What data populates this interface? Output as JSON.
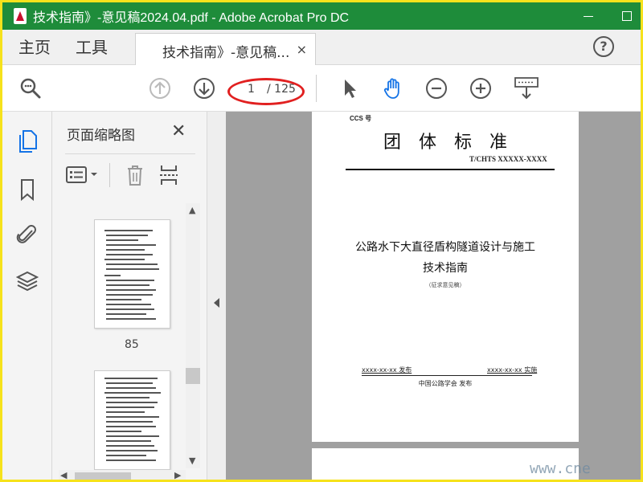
{
  "window": {
    "title": "技术指南》-意见稿2024.04.pdf - Adobe Acrobat Pro DC",
    "accent": "#1e8c3a",
    "border_color": "#f6e21c"
  },
  "tabs": {
    "home": "主页",
    "tools": "工具",
    "document": "技术指南》-意见稿...",
    "close_glyph": "×",
    "help_glyph": "?"
  },
  "toolbar": {
    "current_page": "1",
    "total_pages": "/ 125",
    "icons": [
      "zoom-search-icon",
      "page-up-icon",
      "page-down-icon",
      "select-arrow-icon",
      "hand-tool-icon",
      "zoom-out-icon",
      "zoom-in-icon",
      "keyboard-scroll-icon"
    ]
  },
  "nav": {
    "icons": [
      "page-thumbnails-icon",
      "bookmark-icon",
      "attachment-icon",
      "layers-icon"
    ]
  },
  "thumbnails": {
    "title": "页面缩略图",
    "close_glyph": "✕",
    "page_label": "85"
  },
  "document": {
    "ccs": "CCS 号",
    "heading": "团体标准",
    "code": "T/CHTS XXXXX-XXXX",
    "title_line1": "公路水下大直径盾构隧道设计与施工",
    "title_line2": "技术指南",
    "draft_note": "（征求意见稿）",
    "publish_date": "xxxx-xx-xx 发布",
    "implement_date": "xxxx-xx-xx 实施",
    "organization": "中国公路学会 发布"
  },
  "watermark": "www.cne"
}
